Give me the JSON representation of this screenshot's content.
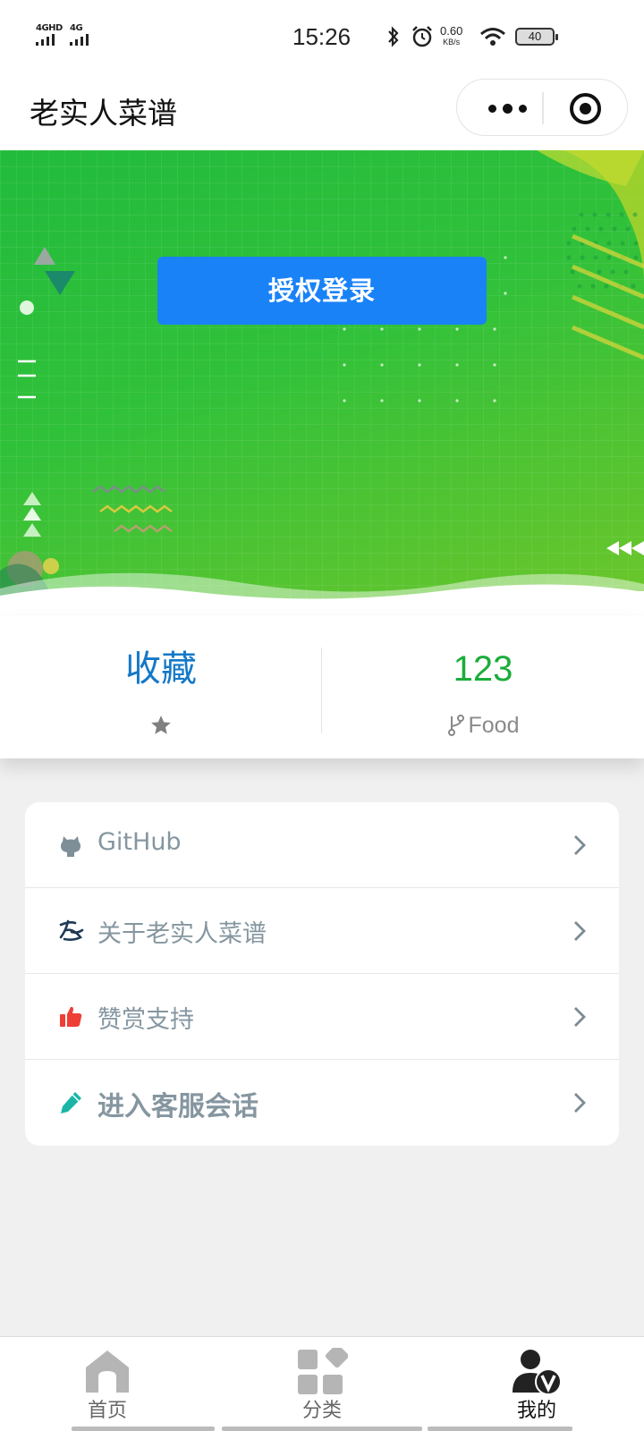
{
  "status_bar": {
    "signal1": "4GHD",
    "signal2": "4G",
    "time": "15:26",
    "net_speed": "0.60",
    "net_unit": "KB/s",
    "battery": "40"
  },
  "nav": {
    "title": "老实人菜谱",
    "more_icon": "more-dots-icon",
    "close_icon": "target-icon"
  },
  "banner": {
    "login_label": "授权登录",
    "accent": "#1a82f7"
  },
  "stats": {
    "left": {
      "value": "收藏",
      "icon": "star-icon"
    },
    "right": {
      "value": "123",
      "label": "Food",
      "icon": "fork-icon"
    }
  },
  "menu": {
    "items": [
      {
        "label": "GitHub",
        "icon": "github-icon"
      },
      {
        "label": "关于老实人菜谱",
        "icon": "about-logo-icon"
      },
      {
        "label": "赞赏支持",
        "icon": "thumbs-up-icon"
      },
      {
        "label": "进入客服会话",
        "icon": "pencil-icon"
      }
    ]
  },
  "tabbar": {
    "tabs": [
      {
        "label": "首页",
        "icon": "home-icon"
      },
      {
        "label": "分类",
        "icon": "category-icon"
      },
      {
        "label": "我的",
        "icon": "user-icon"
      }
    ],
    "active": "我的"
  }
}
